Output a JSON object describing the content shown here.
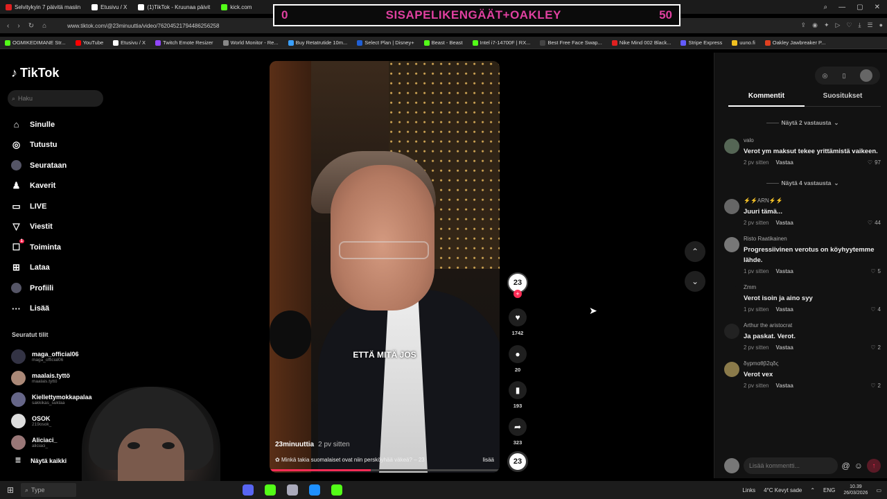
{
  "browser": {
    "tabs": [
      {
        "label": "Selvitykyin 7 päivitä masiin",
        "color": "#e02020"
      },
      {
        "label": "Etusivu / X",
        "color": "#ffffff"
      },
      {
        "label": "(1)TikTok - Kruunaa päivit",
        "color": "#ffffff"
      },
      {
        "label": "kick.com",
        "color": "#53fc18"
      }
    ],
    "url": "www.tiktok.com/@23minuuttia/video/76204521794486256258",
    "bookmarks": [
      {
        "label": "OGMIKEDIMANE Str...",
        "color": "#53fc18"
      },
      {
        "label": "YouTube",
        "color": "#ff0000"
      },
      {
        "label": "Etusivu / X",
        "color": "#ffffff"
      },
      {
        "label": "Twitch Emote Resizer",
        "color": "#9146ff"
      },
      {
        "label": "World Monitor - Re...",
        "color": "#888888"
      },
      {
        "label": "Buy Retatrutide 10m...",
        "color": "#3aa0ff"
      },
      {
        "label": "Select Plan | Disney+",
        "color": "#1f5fd6"
      },
      {
        "label": "Beast - Beast",
        "color": "#53fc18"
      },
      {
        "label": "Intel i7-14700F | RX...",
        "color": "#53fc18"
      },
      {
        "label": "Best Free Face Swap...",
        "color": "#444444"
      },
      {
        "label": "Nike Mind 002 Black...",
        "color": "#e02020"
      },
      {
        "label": "Stripe Express",
        "color": "#635bff"
      },
      {
        "label": "uuno.fi",
        "color": "#f0c020"
      },
      {
        "label": "Oakley Jawbreaker P...",
        "color": "#e04020"
      }
    ]
  },
  "banner": {
    "left": "0",
    "text": "SISAPELIKENGÄÄT+OAKLEY",
    "right": "50"
  },
  "tiktok": {
    "logo": "TikTok",
    "search_placeholder": "Haku",
    "nav": [
      {
        "label": "Sinulle",
        "icon": "home-icon",
        "glyph": "⌂"
      },
      {
        "label": "Tutustu",
        "icon": "compass-icon",
        "glyph": "◎"
      },
      {
        "label": "Seurataan",
        "icon": "following-avatar-icon",
        "glyph": ""
      },
      {
        "label": "Kaverit",
        "icon": "friends-icon",
        "glyph": "♟"
      },
      {
        "label": "LIVE",
        "icon": "live-icon",
        "glyph": "▭"
      },
      {
        "label": "Viestit",
        "icon": "messages-icon",
        "glyph": "▽"
      },
      {
        "label": "Toiminta",
        "icon": "activity-icon",
        "glyph": "☐",
        "badge": "1"
      },
      {
        "label": "Lataa",
        "icon": "upload-icon",
        "glyph": "⊞"
      },
      {
        "label": "Profiili",
        "icon": "profile-icon",
        "glyph": ""
      },
      {
        "label": "Lisää",
        "icon": "more-icon",
        "glyph": "···"
      }
    ],
    "following_title": "Seuratut tilit",
    "following": [
      {
        "name": "maga_official06",
        "handle": "maga_official06"
      },
      {
        "name": "maalais.tyttö",
        "handle": "maalais.tyttö"
      },
      {
        "name": "Kiellettymokkapalaa",
        "handle": "sakkikas_suklaa"
      },
      {
        "name": "OSOK",
        "handle": "219osok_"
      },
      {
        "name": "Aliciaci_",
        "handle": "aliciaci_"
      }
    ],
    "show_all": "Näytä kaikki"
  },
  "video": {
    "caption": "ETTÄ MITÄ JOS",
    "author": "23minuuttia",
    "posted": "2 pv sitten",
    "description": "Minkä takia suomalaiset ovat niin persköyhää väkeä? – 23",
    "more": "lisää",
    "progress": 0.44
  },
  "actions": {
    "avatar_text": "23",
    "likes": "1742",
    "comments": "20",
    "saves": "193",
    "shares": "323"
  },
  "panel": {
    "tabs": [
      "Kommentit",
      "Suositukset"
    ],
    "comments": [
      {
        "type": "more",
        "label": "Näytä 2 vastausta"
      },
      {
        "type": "comment",
        "user": "valo",
        "text": "Verot ym maksut tekee yrittämistä vaikeen.",
        "time": "2 pv sitten",
        "reply": "Vastaa",
        "likes": "97",
        "avatar_color": "#556655"
      },
      {
        "type": "more",
        "label": "Näytä 4 vastausta"
      },
      {
        "type": "comment",
        "user": "⚡⚡ARN⚡⚡",
        "text": "Juuri tämä...",
        "time": "2 pv sitten",
        "reply": "Vastaa",
        "likes": "44",
        "avatar_color": "#666666"
      },
      {
        "type": "comment",
        "user": "Risto Raatikainen",
        "text": "Progressiivinen verotus on köyhyytemme lähde.",
        "time": "1 pv sitten",
        "reply": "Vastaa",
        "likes": "5",
        "avatar_color": "#777777"
      },
      {
        "type": "comment",
        "user": "Zmm",
        "text": "Verot isoin ja aino syy",
        "time": "1 pv sitten",
        "reply": "Vastaa",
        "likes": "4",
        "avatar_color": "#121212"
      },
      {
        "type": "comment",
        "user": "Arthur the aristocrat",
        "text": "Ja paskat. Verot.",
        "time": "2 pv sitten",
        "reply": "Vastaa",
        "likes": "2",
        "avatar_color": "#222222"
      },
      {
        "type": "comment",
        "user": "δγpmαθβ2qδς",
        "text": "Verot vex",
        "time": "2 pv sitten",
        "reply": "Vastaa",
        "likes": "2",
        "avatar_color": "#8a7a4a"
      }
    ],
    "input_placeholder": "Lisää kommentti..."
  },
  "taskbar": {
    "search": "Type",
    "links": "Links",
    "weather": "4°C  Kevyt sade",
    "lang": "ENG",
    "time": "10.39",
    "date": "26/03/2026"
  }
}
